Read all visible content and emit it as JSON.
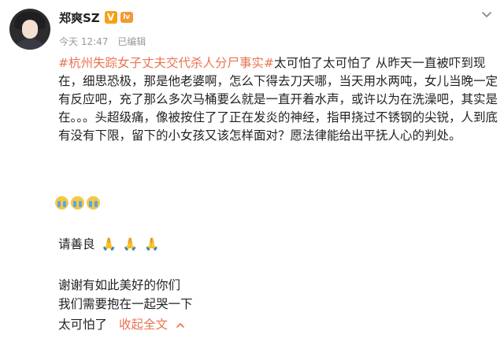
{
  "user": {
    "name": "郑爽SZ",
    "vip_badge": "V",
    "level_badge": "lv",
    "time": "今天 12:47",
    "edited": "已编辑"
  },
  "post": {
    "hashtag": "#杭州失踪女子丈夫交代杀人分尸事实#",
    "body": "太可怕了太可怕了 从昨天一直被吓到现在，细思恐极，那是他老婆啊，怎么下得去刀天哪，当天用水两吨，女儿当晚一定有反应吧，充了那么多次马桶要么就是一直开着水声，或许以为在洗澡吧，其实是在。。。头超级痛，像被按住了了正在发炎的神经，指甲挠过不锈钢的尖锐，人到底有没有下限，留下的小女孩又该怎样面对？愿法律能给出平抚人心的判处。",
    "line_kind": "请善良",
    "line_thanks": "谢谢有如此美好的你们",
    "line_hug": "我们需要抱在一起哭一下",
    "line_scary": "太可怕了",
    "collapse_label": "收起全文"
  },
  "icons": {
    "menu": "chevron-down-icon",
    "emoji": "crying-face-icon",
    "pray": "praying-hands-icon",
    "collapse": "chevron-up-icon"
  },
  "colors": {
    "hashtag": "#eb7350",
    "meta": "#999999",
    "text": "#222222"
  }
}
